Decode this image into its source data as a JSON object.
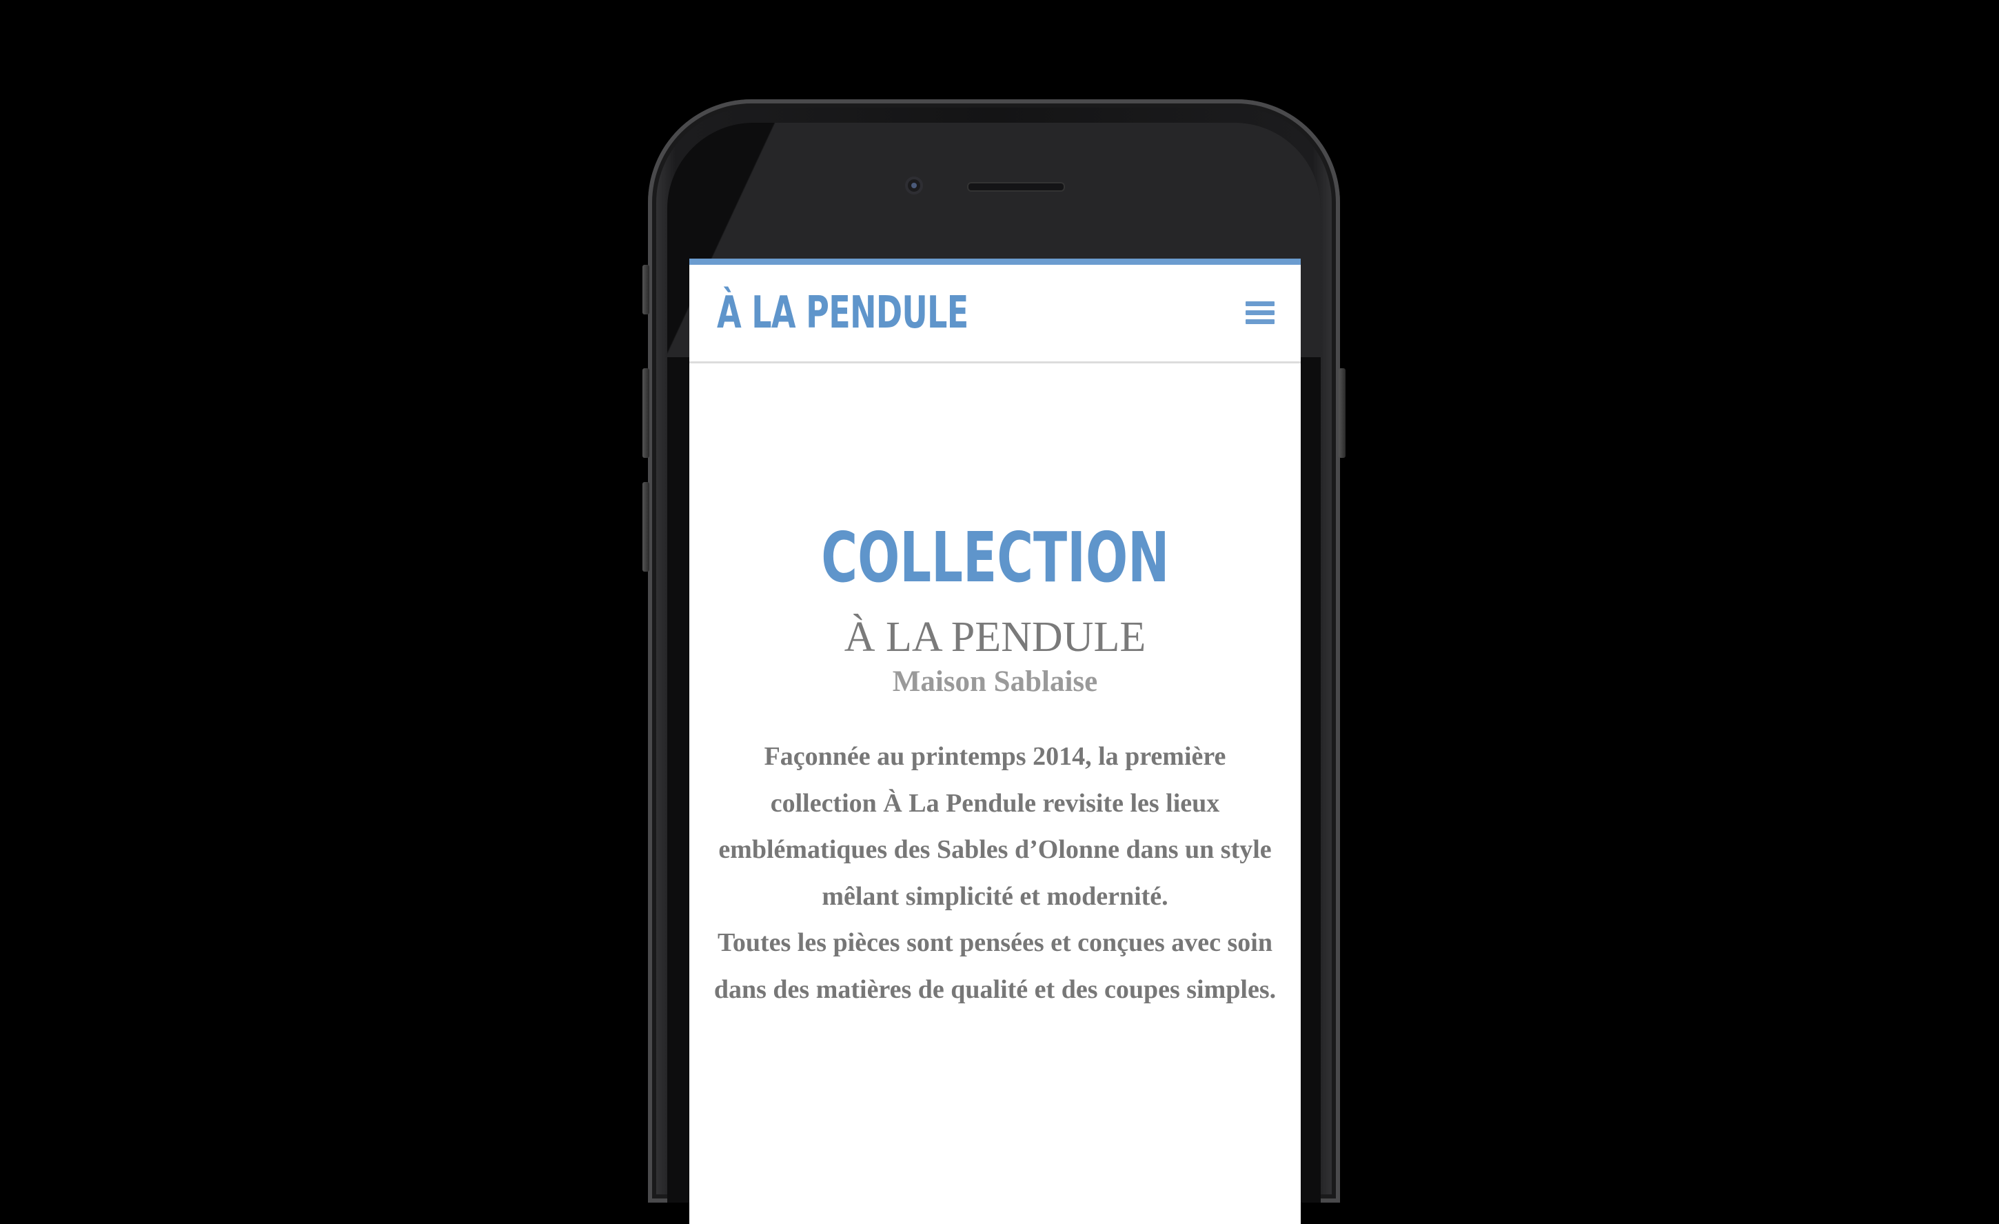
{
  "header": {
    "brand": "À LA PENDULE",
    "menu_icon": "hamburger-menu-icon"
  },
  "main": {
    "section_title": "COLLECTION",
    "brand_name": "À LA PENDULE",
    "tagline": "Maison Sablaise",
    "paragraph_1": "Façonnée au printemps 2014, la première collection À La Pendule revisite les lieux emblématiques des Sables d’Olonne dans un style mêlant simplicité et modernité.",
    "paragraph_2": "Toutes les pièces sont pensées et conçues avec soin dans des matières de qualité et des coupes simples."
  },
  "colors": {
    "accent": "#6b9ccf",
    "text": "#777777",
    "background": "#000000",
    "screen": "#ffffff"
  }
}
